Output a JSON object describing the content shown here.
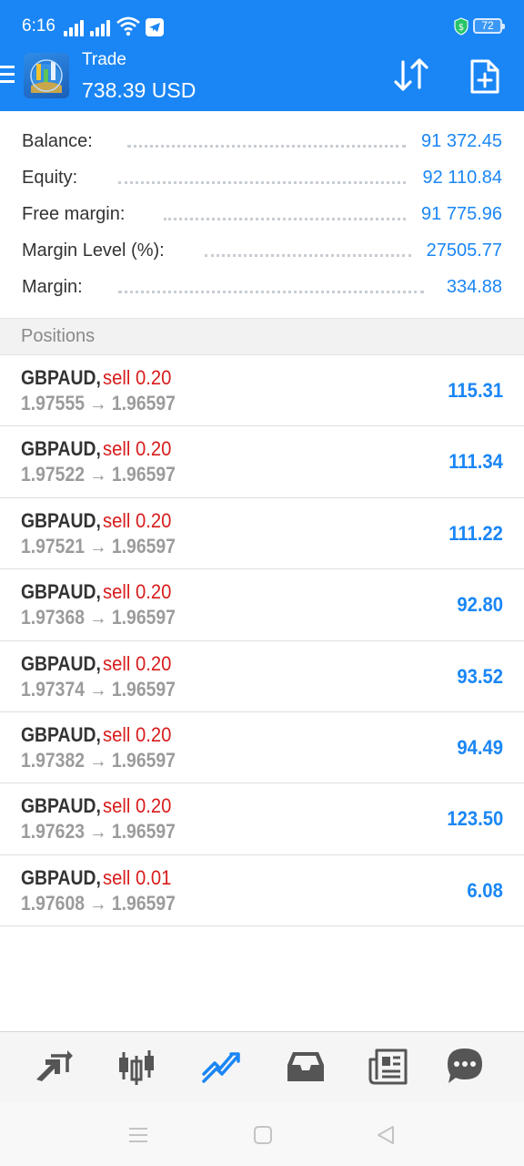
{
  "status_bar": {
    "time": "6:16",
    "battery": "72"
  },
  "header": {
    "title": "Trade",
    "balance": "738.39 USD"
  },
  "summary": [
    {
      "label": "Balance:",
      "value": "91 372.45"
    },
    {
      "label": "Equity:",
      "value": "92 110.84"
    },
    {
      "label": "Free margin:",
      "value": "91 775.96"
    },
    {
      "label": "Margin Level (%):",
      "value": "27505.77"
    },
    {
      "label": "Margin:",
      "value": "334.88"
    }
  ],
  "positions_title": "Positions",
  "positions": [
    {
      "symbol": "GBPAUD,",
      "type": "sell 0.20",
      "open": "1.97555",
      "arrow": "→",
      "current": "1.96597",
      "profit": "115.31"
    },
    {
      "symbol": "GBPAUD,",
      "type": "sell 0.20",
      "open": "1.97522",
      "arrow": "→",
      "current": "1.96597",
      "profit": "111.34"
    },
    {
      "symbol": "GBPAUD,",
      "type": "sell 0.20",
      "open": "1.97521",
      "arrow": "→",
      "current": "1.96597",
      "profit": "111.22"
    },
    {
      "symbol": "GBPAUD,",
      "type": "sell 0.20",
      "open": "1.97368",
      "arrow": "→",
      "current": "1.96597",
      "profit": "92.80"
    },
    {
      "symbol": "GBPAUD,",
      "type": "sell 0.20",
      "open": "1.97374",
      "arrow": "→",
      "current": "1.96597",
      "profit": "93.52"
    },
    {
      "symbol": "GBPAUD,",
      "type": "sell 0.20",
      "open": "1.97382",
      "arrow": "→",
      "current": "1.96597",
      "profit": "94.49"
    },
    {
      "symbol": "GBPAUD,",
      "type": "sell 0.20",
      "open": "1.97623",
      "arrow": "→",
      "current": "1.96597",
      "profit": "123.50"
    },
    {
      "symbol": "GBPAUD,",
      "type": "sell 0.01",
      "open": "1.97608",
      "arrow": "→",
      "current": "1.96597",
      "profit": "6.08"
    }
  ],
  "bottom_nav": [
    {
      "icon": "quotes-icon",
      "active": false
    },
    {
      "icon": "chart-icon",
      "active": false
    },
    {
      "icon": "trade-icon",
      "active": true
    },
    {
      "icon": "history-icon",
      "active": false
    },
    {
      "icon": "news-icon",
      "active": false
    },
    {
      "icon": "messages-icon",
      "active": false
    }
  ],
  "colors": {
    "header_bg": "#1a86f5",
    "accent": "#1a86f5",
    "sell": "#d81b1b",
    "text": "#333333",
    "muted": "#9b9b9b",
    "nav_icon": "#555555"
  }
}
